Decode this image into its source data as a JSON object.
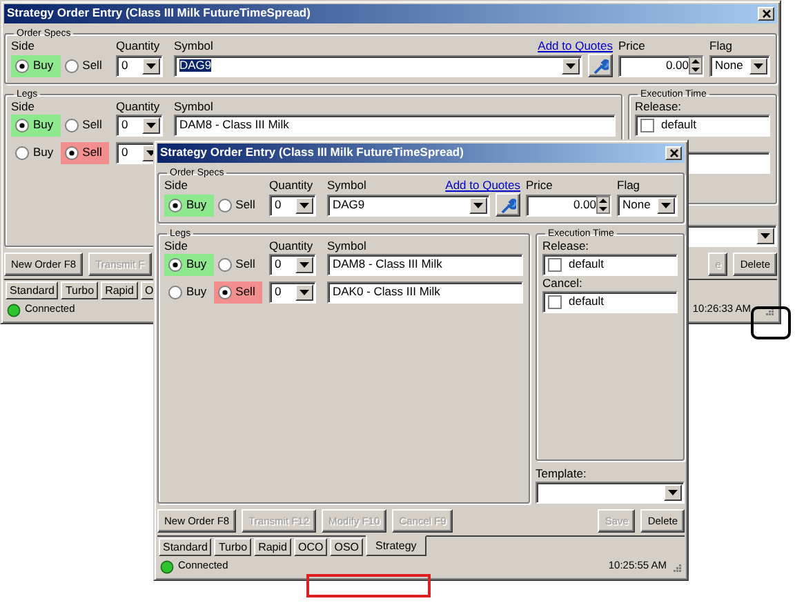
{
  "windows": [
    {
      "title": "Strategy Order Entry (Class III Milk FutureTimeSpread)",
      "order_specs": {
        "legend": "Order Specs",
        "headers": {
          "side": "Side",
          "quantity": "Quantity",
          "symbol": "Symbol",
          "add_link": "Add to Quotes",
          "price": "Price",
          "flag": "Flag"
        },
        "side": [
          {
            "kind": "buy",
            "label": "Buy",
            "selected": true
          },
          {
            "kind": "sell",
            "label": "Sell",
            "selected": false
          }
        ],
        "quantity": "0",
        "symbol": "DAG9",
        "symbol_highlighted": true,
        "price": "0.00",
        "flag": "None"
      },
      "legs": {
        "legend": "Legs",
        "headers": {
          "side": "Side",
          "quantity": "Quantity",
          "symbol": "Symbol"
        },
        "rows": [
          {
            "side": [
              {
                "kind": "buy",
                "label": "Buy",
                "selected": true
              },
              {
                "kind": "sell",
                "label": "Sell",
                "selected": false
              }
            ],
            "quantity": "0",
            "symbol": "DAM8 - Class III Milk"
          },
          {
            "side": [
              {
                "kind": "buy",
                "label": "Buy",
                "selected": false
              },
              {
                "kind": "sell",
                "label": "Sell",
                "selected": true
              }
            ],
            "quantity": "0"
          }
        ]
      },
      "execution_time": {
        "legend": "Execution Time",
        "fields": [
          {
            "kind": "option",
            "label": "Release:",
            "option": "default",
            "checked": false
          },
          {
            "kind": "blank"
          }
        ]
      },
      "buttons": [
        {
          "label": "New Order F8",
          "disabled": false
        },
        {
          "label": "Transmit F",
          "disabled": true
        }
      ],
      "right_buttons": [
        {
          "label": "e",
          "disabled": true
        },
        {
          "label": "Delete",
          "disabled": false
        }
      ],
      "tabs": [
        {
          "label": "Standard",
          "selected": false
        },
        {
          "label": "Turbo",
          "selected": false
        },
        {
          "label": "Rapid",
          "selected": false
        },
        {
          "label": "O",
          "selected": false
        }
      ],
      "status": {
        "connected": true,
        "text": "Connected",
        "time": "10:26:33 AM"
      }
    },
    {
      "title": "Strategy Order Entry (Class III Milk FutureTimeSpread)",
      "order_specs": {
        "legend": "Order Specs",
        "headers": {
          "side": "Side",
          "quantity": "Quantity",
          "symbol": "Symbol",
          "add_link": "Add to Quotes",
          "price": "Price",
          "flag": "Flag"
        },
        "side": [
          {
            "kind": "buy",
            "label": "Buy",
            "selected": true
          },
          {
            "kind": "sell",
            "label": "Sell",
            "selected": false
          }
        ],
        "quantity": "0",
        "symbol": "DAG9",
        "symbol_highlighted": false,
        "price": "0.00",
        "flag": "None"
      },
      "legs": {
        "legend": "Legs",
        "headers": {
          "side": "Side",
          "quantity": "Quantity",
          "symbol": "Symbol"
        },
        "rows": [
          {
            "side": [
              {
                "kind": "buy",
                "label": "Buy",
                "selected": true
              },
              {
                "kind": "sell",
                "label": "Sell",
                "selected": false
              }
            ],
            "quantity": "0",
            "symbol": "DAM8 - Class III Milk"
          },
          {
            "side": [
              {
                "kind": "buy",
                "label": "Buy",
                "selected": false
              },
              {
                "kind": "sell",
                "label": "Sell",
                "selected": true
              }
            ],
            "quantity": "0",
            "symbol": "DAK0 - Class III Milk"
          }
        ]
      },
      "execution_time": {
        "legend": "Execution Time",
        "fields": [
          {
            "kind": "option",
            "label": "Release:",
            "option": "default",
            "checked": false
          },
          {
            "kind": "option",
            "label": "Cancel:",
            "option": "default",
            "checked": false
          }
        ]
      },
      "template": {
        "label": "Template:"
      },
      "buttons": [
        {
          "label": "New Order F8",
          "disabled": false
        },
        {
          "label": "Transmit F12",
          "disabled": true
        },
        {
          "label": "Modify F10",
          "disabled": true
        },
        {
          "label": "Cancel F9",
          "disabled": true
        }
      ],
      "right_buttons": [
        {
          "label": "Save",
          "disabled": true
        },
        {
          "label": "Delete",
          "disabled": false
        }
      ],
      "tabs": [
        {
          "label": "Standard",
          "selected": false
        },
        {
          "label": "Turbo",
          "selected": false
        },
        {
          "label": "Rapid",
          "selected": false
        },
        {
          "label": "OCO",
          "selected": false
        },
        {
          "label": "OSO",
          "selected": false
        },
        {
          "label": "Strategy",
          "selected": true
        }
      ],
      "status": {
        "connected": true,
        "text": "Connected",
        "time": "10:25:55 AM"
      }
    }
  ],
  "annotations": [
    {
      "color": "#000000"
    },
    {
      "color": "#e02020"
    }
  ]
}
